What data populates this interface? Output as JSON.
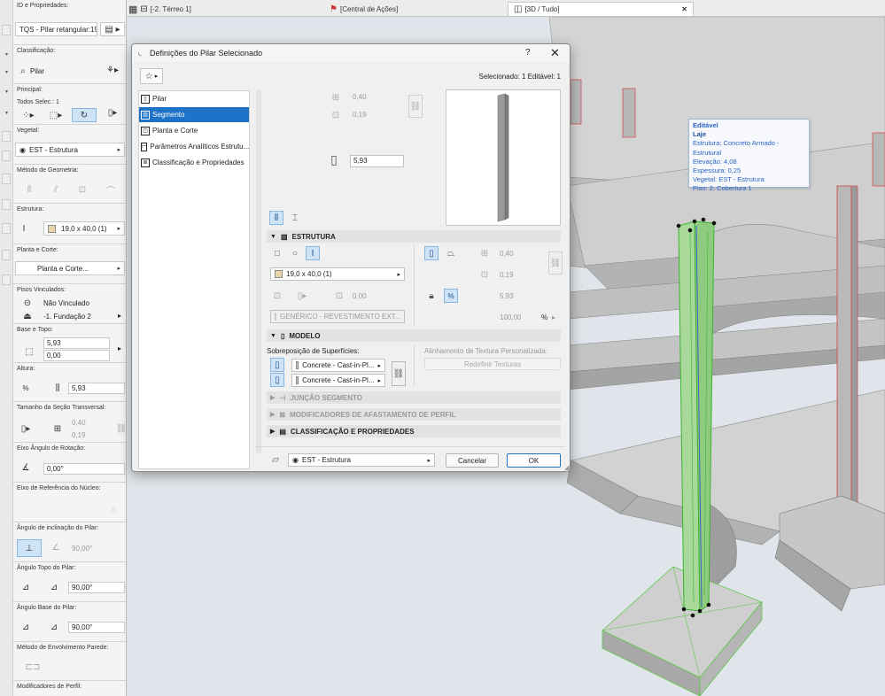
{
  "tabs": [
    {
      "label": "[-2. Térreo 1]"
    },
    {
      "label": "[Central de Ações]"
    },
    {
      "label": "[3D / Tudo]"
    }
  ],
  "infobox": {
    "id_label": "ID e Propriedades:",
    "id_value": "TQS - Pilar retangular:19.",
    "class_label": "Classificação:",
    "class_value": "Pilar",
    "principal_label": "Principal:",
    "all_sel_label": "Todos Selec.: 1",
    "vegetal_label": "Vegetal:",
    "vegetal_value": "EST - Estrutura",
    "geometry_label": "Método de Geometria:",
    "structure_label": "Estrutura:",
    "structure_value": "19,0 x 40,0 (1)",
    "plan_label": "Planta e Corte:",
    "plan_value": "Planta e Corte...",
    "linked_label": "Pisos Vinculados:",
    "linked_top": "Não Vinculado",
    "linked_bottom": "-1. Fundação 2",
    "base_top_label": "Base e Topo:",
    "top_value": "5,93",
    "base_value": "0,00",
    "height_label": "Altura:",
    "height_value": "5,93",
    "section_label": "Tamanho da Seção Transversal:",
    "section_w": "0,40",
    "section_h": "0,19",
    "rotation_label": "Eixo Ângulo de Rotação:",
    "rotation_value": "0,00°",
    "core_label": "Eixo de Referência do Núcleo:",
    "slant_label": "Ângulo de inclinação do Pilar:",
    "slant_value": "90,00°",
    "top_angle_label": "Ângulo Topo do Pilar:",
    "top_angle_value": "90,00°",
    "base_angle_label": "Ângulo Base do Pilar:",
    "base_angle_value": "90,00°",
    "wrap_label": "Método de Envolvimento Parede:",
    "profile_label": "Modificadores de Perfil:"
  },
  "tooltip": {
    "title": "Editável",
    "type": "Laje",
    "lines": [
      "Estrutura: Concreto Armado - Estrutural",
      "Elevação: 4,08",
      "Espessura: 0,25",
      "Vegetal: EST - Estrutura",
      "Piso: 2. Cobertura 1"
    ]
  },
  "dialog": {
    "title": "Definições do Pilar Selecionado",
    "help": "?",
    "close": "✕",
    "selected_info": "Selecionado: 1 Editável: 1",
    "nav": [
      {
        "label": "Pilar",
        "selected": false
      },
      {
        "label": "Segmento",
        "selected": true
      },
      {
        "label": "Planta e Corte",
        "selected": false
      },
      {
        "label": "Parâmetros Analíticos Estrutu...",
        "selected": false
      },
      {
        "label": "Classificação e Propriedades",
        "selected": false
      }
    ],
    "dims": {
      "width": "0,40",
      "depth": "0,19",
      "height": "5,93"
    },
    "estrutura": {
      "header": "ESTRUTURA",
      "profile": "19,0 x 40,0 (1)",
      "offset": "0,00",
      "w": "0,40",
      "h": "0,19",
      "height": "5,93",
      "material": "GENÉRICO - REVESTIMENTO EXT...",
      "percent": "100,00",
      "percent_unit": "%"
    },
    "modelo": {
      "header": "MODELO",
      "surface_label": "Sobreposição de Superfícies:",
      "surface_1": "Concrete - Cast-in-Pl...",
      "surface_2": "Concrete - Cast-in-Pl...",
      "texture_label": "Alinhamento de Textura Personalizada:",
      "texture_button": "Redefinir Texturas"
    },
    "collapsed": [
      {
        "label": "JUNÇÃO SEGMENTO",
        "dim": true
      },
      {
        "label": "MODIFICADORES DE AFASTAMENTO DE PERFIL",
        "dim": true
      },
      {
        "label": "CLASSIFICAÇÃO E PROPRIEDADES",
        "dim": false
      }
    ],
    "footer": {
      "layer": "EST - Estrutura",
      "cancel": "Cancelar",
      "ok": "OK"
    }
  },
  "colors": {
    "selection_blue": "#1e73c8",
    "column_green": "#5fc84a",
    "concrete": "#c8c8c8"
  }
}
